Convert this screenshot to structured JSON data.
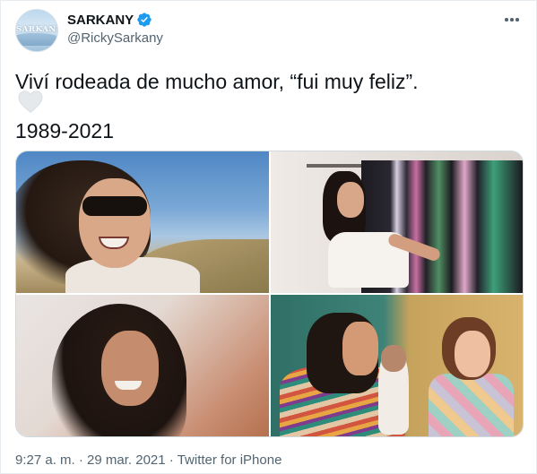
{
  "tweet": {
    "author": {
      "display_name": "SARKANY",
      "handle": "@RickySarkany",
      "avatar_text": "SARKANY",
      "verified": true
    },
    "text": "Viví rodeada de mucho amor, “fui muy feliz”.",
    "emoji": "white-heart-icon",
    "years": "1989-2021",
    "photos": [
      {
        "name": "photo-beach"
      },
      {
        "name": "photo-closet"
      },
      {
        "name": "photo-portrait"
      },
      {
        "name": "photo-paintings"
      }
    ],
    "meta": {
      "time": "9:27 a. m.",
      "separator": "·",
      "date": "29 mar. 2021",
      "source": "Twitter for iPhone"
    }
  },
  "colors": {
    "text_primary": "#0f1419",
    "text_secondary": "#536471",
    "verified_blue": "#1d9bf0",
    "border": "#cfd9de"
  }
}
